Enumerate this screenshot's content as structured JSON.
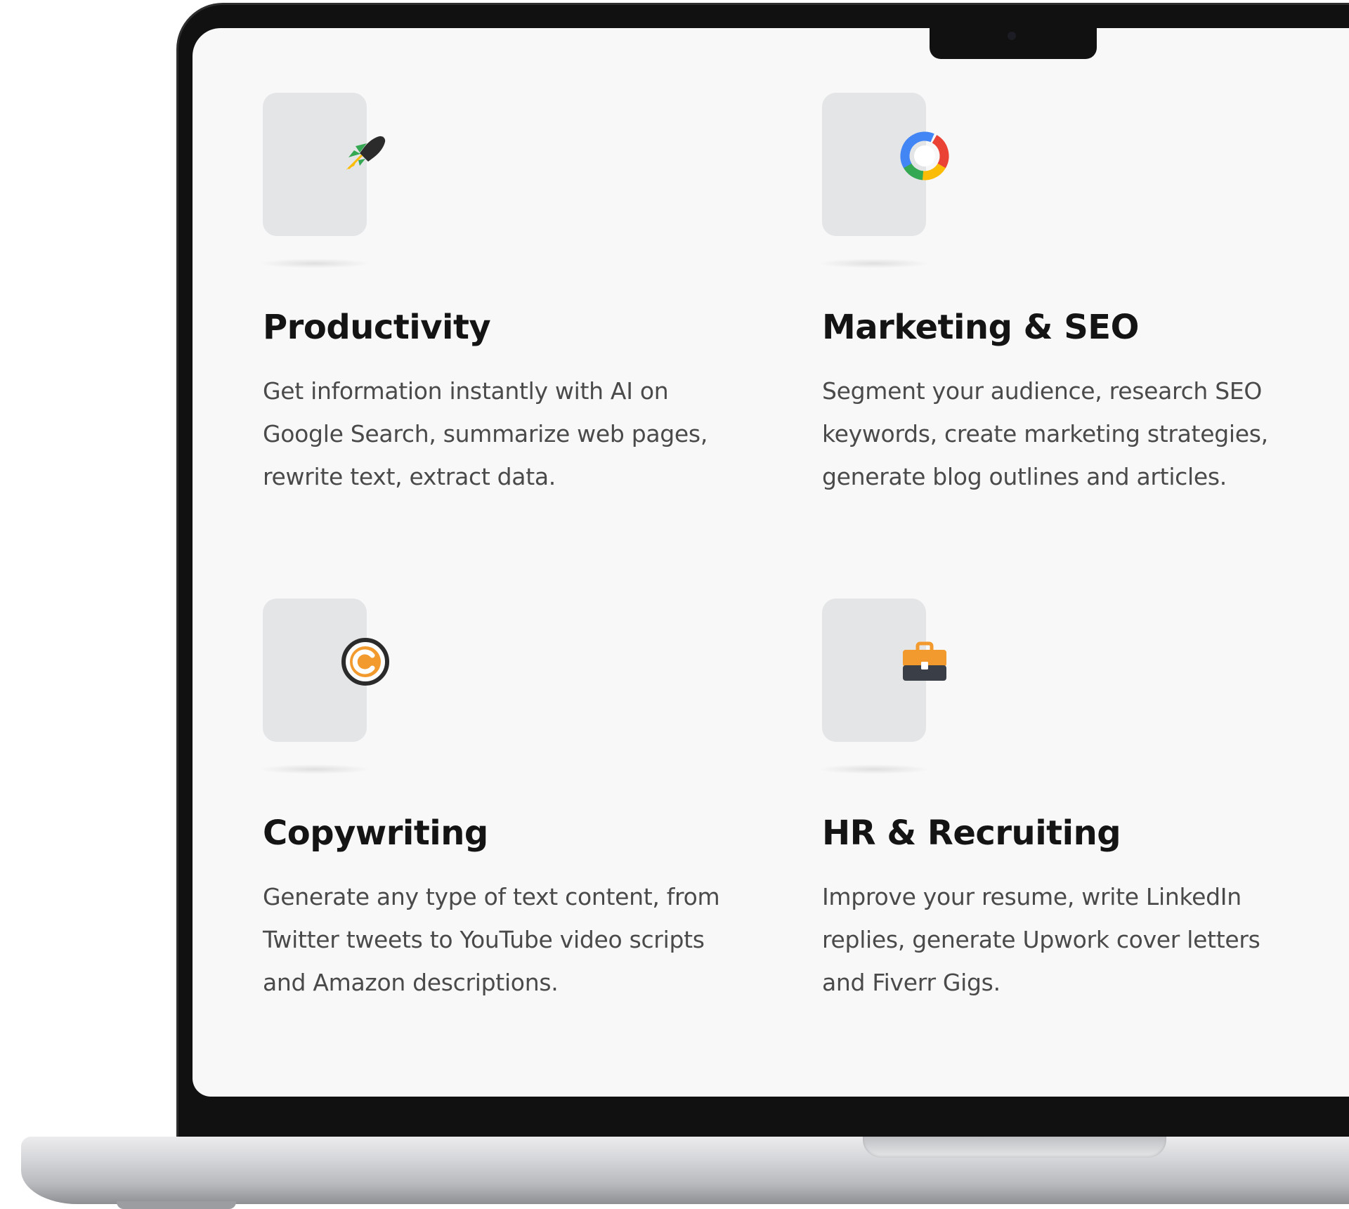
{
  "features": [
    {
      "icon": "rocket-icon",
      "title": "Productivity",
      "description": "Get information instantly with AI on Google Search, summarize web pages, rewrite text, extract data."
    },
    {
      "icon": "google-ads-icon",
      "title": "Marketing & SEO",
      "description": "Segment your audience, research SEO keywords, create marketing strategies, generate blog outlines and articles."
    },
    {
      "icon": "copyright-icon",
      "title": "Copywriting",
      "description": "Generate any type of text content, from Twitter tweets to YouTube video scripts and Amazon descriptions."
    },
    {
      "icon": "briefcase-icon",
      "title": "HR & Recruiting",
      "description": "Improve your resume, write LinkedIn replies, generate Upwork cover letters and Fiverr Gigs."
    }
  ],
  "colors": {
    "screen_background": "#f8f8f8",
    "icon_tile": "#e4e5e7",
    "title_text": "#141414",
    "body_text": "#4a4a4a",
    "google_blue": "#4285f4",
    "google_red": "#ea4335",
    "google_yellow": "#fbbc05",
    "google_green": "#34a853",
    "accent_orange": "#f29a2e"
  }
}
